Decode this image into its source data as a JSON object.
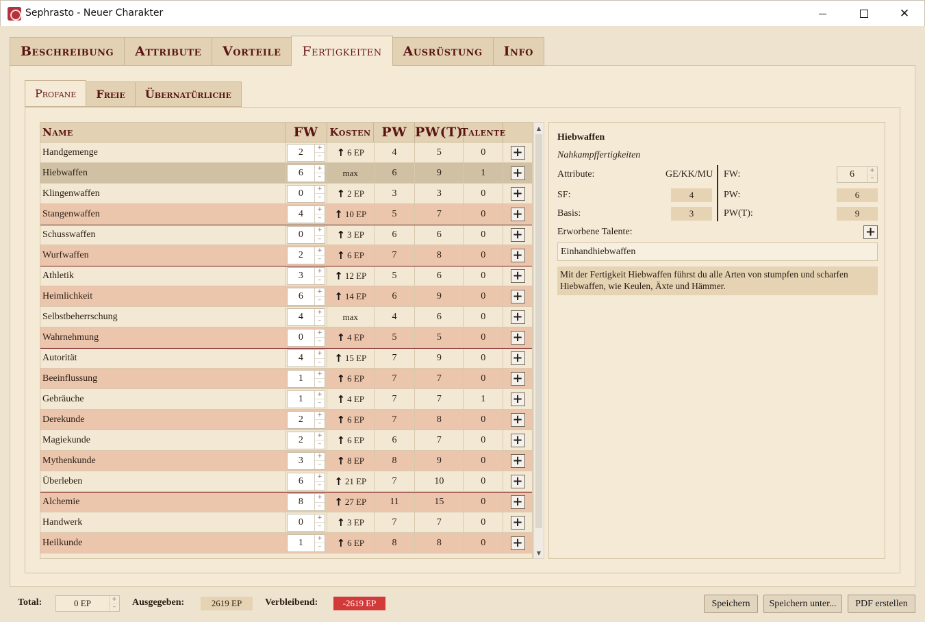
{
  "window": {
    "title": "Sephrasto - Neuer Charakter",
    "minimize": "–",
    "maximize": "□",
    "close": "✕"
  },
  "main_tabs": [
    "Beschreibung",
    "Attribute",
    "Vorteile",
    "Fertigkeiten",
    "Ausrüstung",
    "Info"
  ],
  "main_tab_active": "Fertigkeiten",
  "sub_tabs": [
    "Profane",
    "Freie",
    "Übernatürliche"
  ],
  "sub_tab_active": "Profane",
  "table": {
    "headers": {
      "name": "Name",
      "fw": "FW",
      "kosten": "Kosten",
      "pw": "PW",
      "pwt": "PW(T)",
      "talente": "Talente"
    },
    "rows": [
      {
        "name": "Handgemenge",
        "fw": "2",
        "kosten": "6 EP",
        "pw": "4",
        "pwt": "5",
        "talente": "0"
      },
      {
        "name": "Hiebwaffen",
        "fw": "6",
        "kosten": "max",
        "pw": "6",
        "pwt": "9",
        "talente": "1"
      },
      {
        "name": "Klingenwaffen",
        "fw": "0",
        "kosten": "2 EP",
        "pw": "3",
        "pwt": "3",
        "talente": "0"
      },
      {
        "name": "Stangenwaffen",
        "fw": "4",
        "kosten": "10 EP",
        "pw": "5",
        "pwt": "7",
        "talente": "0"
      },
      {
        "name": "Schusswaffen",
        "fw": "0",
        "kosten": "3 EP",
        "pw": "6",
        "pwt": "6",
        "talente": "0"
      },
      {
        "name": "Wurfwaffen",
        "fw": "2",
        "kosten": "6 EP",
        "pw": "7",
        "pwt": "8",
        "talente": "0"
      },
      {
        "name": "Athletik",
        "fw": "3",
        "kosten": "12 EP",
        "pw": "5",
        "pwt": "6",
        "talente": "0"
      },
      {
        "name": "Heimlichkeit",
        "fw": "6",
        "kosten": "14 EP",
        "pw": "6",
        "pwt": "9",
        "talente": "0"
      },
      {
        "name": "Selbstbeherrschung",
        "fw": "4",
        "kosten": "max",
        "pw": "4",
        "pwt": "6",
        "talente": "0"
      },
      {
        "name": "Wahrnehmung",
        "fw": "0",
        "kosten": "4 EP",
        "pw": "5",
        "pwt": "5",
        "talente": "0"
      },
      {
        "name": "Autorität",
        "fw": "4",
        "kosten": "15 EP",
        "pw": "7",
        "pwt": "9",
        "talente": "0"
      },
      {
        "name": "Beeinflussung",
        "fw": "1",
        "kosten": "6 EP",
        "pw": "7",
        "pwt": "7",
        "talente": "0"
      },
      {
        "name": "Gebräuche",
        "fw": "1",
        "kosten": "4 EP",
        "pw": "7",
        "pwt": "7",
        "talente": "1"
      },
      {
        "name": "Derekunde",
        "fw": "2",
        "kosten": "6 EP",
        "pw": "7",
        "pwt": "8",
        "talente": "0"
      },
      {
        "name": "Magiekunde",
        "fw": "2",
        "kosten": "6 EP",
        "pw": "6",
        "pwt": "7",
        "talente": "0"
      },
      {
        "name": "Mythenkunde",
        "fw": "3",
        "kosten": "8 EP",
        "pw": "8",
        "pwt": "9",
        "talente": "0"
      },
      {
        "name": "Überleben",
        "fw": "6",
        "kosten": "21 EP",
        "pw": "7",
        "pwt": "10",
        "talente": "0"
      },
      {
        "name": "Alchemie",
        "fw": "8",
        "kosten": "27 EP",
        "pw": "11",
        "pwt": "15",
        "talente": "0"
      },
      {
        "name": "Handwerk",
        "fw": "0",
        "kosten": "3 EP",
        "pw": "7",
        "pwt": "7",
        "talente": "0"
      },
      {
        "name": "Heilkunde",
        "fw": "1",
        "kosten": "6 EP",
        "pw": "8",
        "pwt": "8",
        "talente": "0"
      }
    ]
  },
  "detail": {
    "title": "Hiebwaffen",
    "category": "Nahkampffertigkeiten",
    "attribute_label": "Attribute:",
    "attribute_value": "GE/KK/MU",
    "sf_label": "SF:",
    "sf_value": "4",
    "basis_label": "Basis:",
    "basis_value": "3",
    "fw_label": "FW:",
    "fw_value": "6",
    "pw_label": "PW:",
    "pw_value": "6",
    "pwt_label": "PW(T):",
    "pwt_value": "9",
    "talents_label": "Erworbene Talente:",
    "talents": "Einhandhiebwaffen",
    "description": "Mit der Fertigkeit Hiebwaffen führst du alle Arten von stumpfen und scharfen Hiebwaffen, wie Keulen, Äxte und Hämmer."
  },
  "footer": {
    "total_label": "Total:",
    "total_value": "0 EP",
    "spent_label": "Ausgegeben:",
    "spent_value": "2619 EP",
    "remaining_label": "Verbleibend:",
    "remaining_value": "-2619 EP",
    "save": "Speichern",
    "save_as": "Speichern unter...",
    "pdf": "PDF erstellen"
  },
  "icons": {
    "cost_up": "arrow-up-icon",
    "add": "plus-icon",
    "spin_up": "+",
    "spin_down": "–"
  },
  "colors": {
    "remaining_bg": "#d23a3a",
    "accent": "#5a1414",
    "row_pink": "#ebc6ad",
    "row_selected": "#d0c1a5"
  }
}
